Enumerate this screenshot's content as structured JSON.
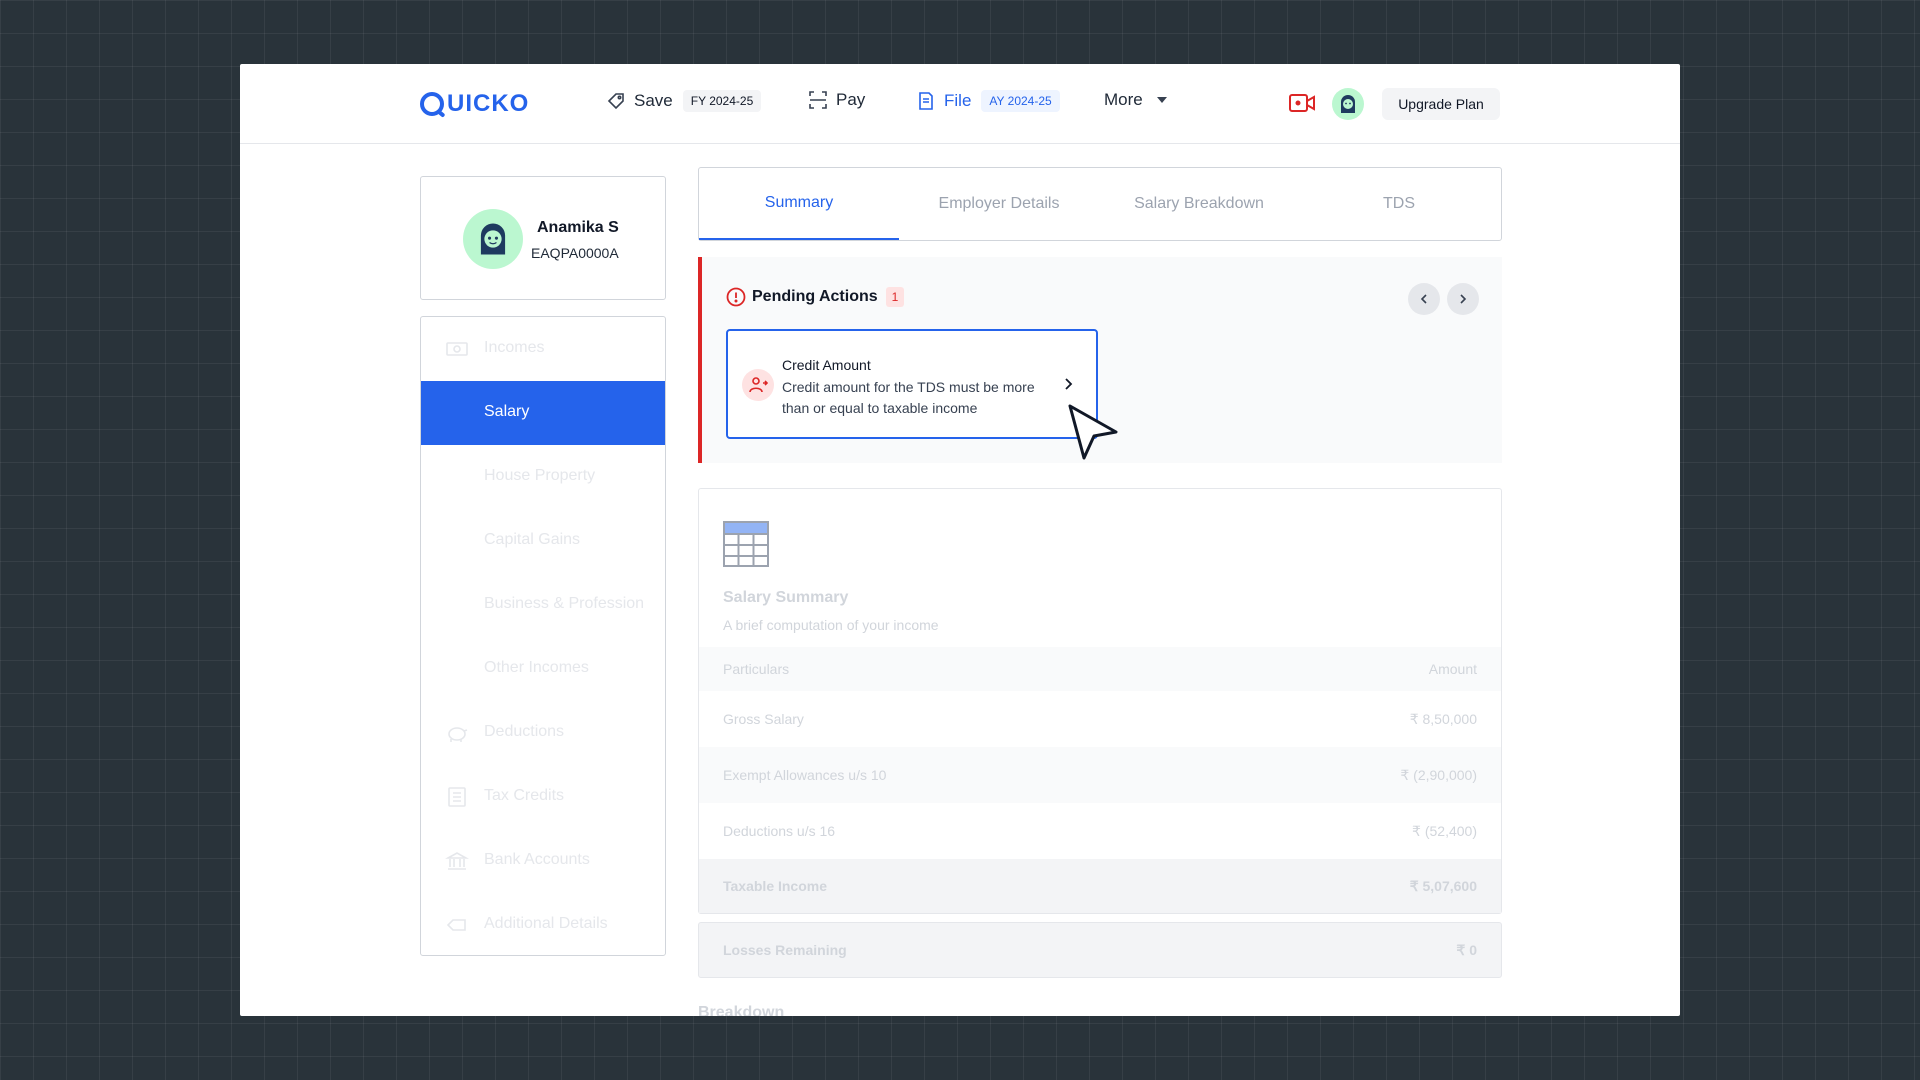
{
  "brand": {
    "name": "UICKO"
  },
  "nav": {
    "save": {
      "label": "Save",
      "badge": "FY 2024-25"
    },
    "pay": {
      "label": "Pay"
    },
    "file": {
      "label": "File",
      "badge": "AY 2024-25"
    },
    "more": {
      "label": "More"
    },
    "upgrade": "Upgrade Plan"
  },
  "profile": {
    "name": "Anamika S",
    "id": "EAQPA0000A"
  },
  "sidebar": {
    "items": [
      {
        "label": "Incomes",
        "icon": "cash-icon"
      },
      {
        "label": "Salary",
        "icon": "",
        "active": true
      },
      {
        "label": "House Property",
        "icon": ""
      },
      {
        "label": "Capital Gains",
        "icon": ""
      },
      {
        "label": "Business & Profession",
        "icon": ""
      },
      {
        "label": "Other Incomes",
        "icon": ""
      },
      {
        "label": "Deductions",
        "icon": "piggy-bank-icon"
      },
      {
        "label": "Tax Credits",
        "icon": "receipt-icon"
      },
      {
        "label": "Bank Accounts",
        "icon": "bank-icon"
      },
      {
        "label": "Additional Details",
        "icon": "tag-icon"
      }
    ]
  },
  "tabs": [
    "Summary",
    "Employer Details",
    "Salary Breakdown",
    "TDS"
  ],
  "pending": {
    "title": "Pending Actions",
    "count": "1",
    "card": {
      "title": "Credit Amount",
      "description": "Credit amount for the TDS must be more than or equal to taxable income"
    }
  },
  "summary": {
    "title": "Salary Summary",
    "subtitle": "A brief computation of your income",
    "headers": {
      "left": "Particulars",
      "right": "Amount"
    },
    "rows": [
      {
        "label": "Gross Salary",
        "amount": "₹ 8,50,000"
      },
      {
        "label": "Exempt Allowances u/s 10",
        "amount": "₹ (2,90,000)"
      },
      {
        "label": "Deductions u/s 16",
        "amount": "₹ (52,400)"
      }
    ],
    "total": {
      "label": "Taxable Income",
      "amount": "₹ 5,07,600"
    }
  },
  "losses": {
    "label": "Losses Remaining",
    "amount": "₹ 0"
  },
  "breakdown_label": "Breakdown",
  "colors": {
    "accent": "#2563eb",
    "danger": "#dc2626",
    "background": "#29333a"
  }
}
